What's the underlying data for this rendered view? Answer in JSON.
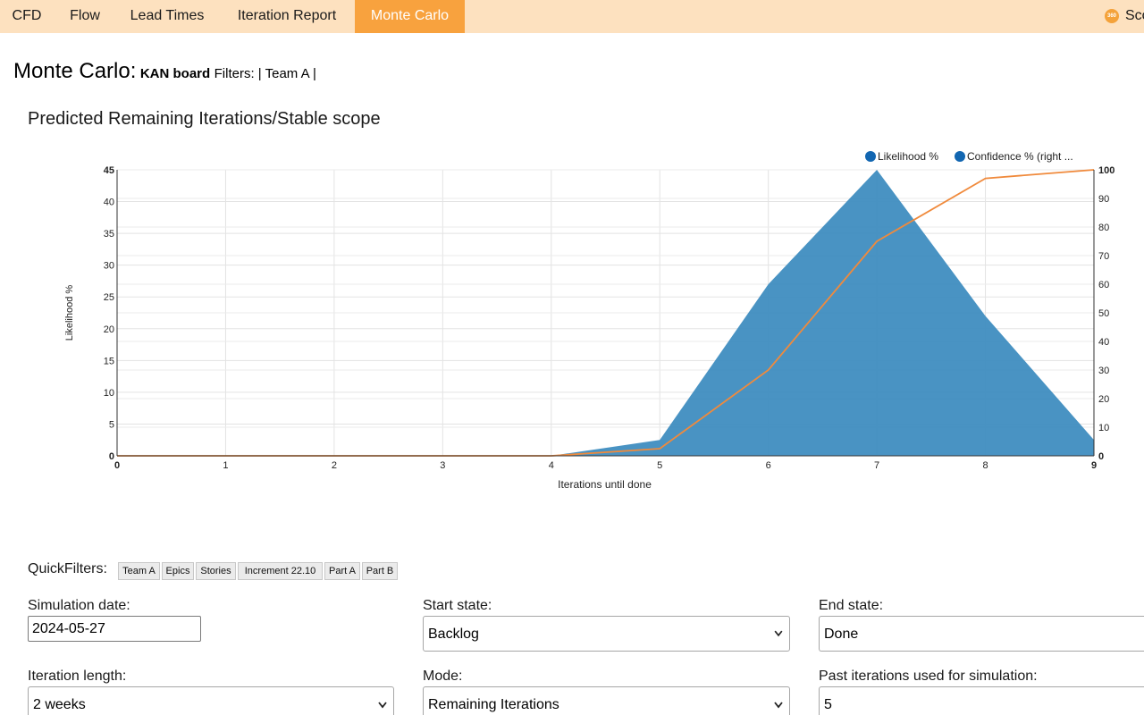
{
  "nav": {
    "tabs": [
      "CFD",
      "Flow",
      "Lead Times",
      "Iteration Report",
      "Monte Carlo"
    ],
    "active_index": 4,
    "brand_label": "Sco",
    "brand_icon_text": "360"
  },
  "page": {
    "title": "Monte Carlo:",
    "board": "KAN board",
    "filters": "Filters: | Team A |"
  },
  "chart_title": "Predicted Remaining Iterations/Stable scope",
  "chart_data": {
    "type": "area",
    "x": [
      0,
      1,
      2,
      3,
      4,
      5,
      6,
      7,
      8,
      9
    ],
    "x_ticks": [
      "0",
      "1",
      "2",
      "3",
      "4",
      "5",
      "6",
      "7",
      "8",
      "9"
    ],
    "xlabel": "Iterations until done",
    "ylabel": "Likelihood %",
    "ylim": [
      0,
      45
    ],
    "y_ticks": [
      "0",
      "5",
      "10",
      "15",
      "20",
      "25",
      "30",
      "35",
      "40",
      "45"
    ],
    "y2lim": [
      0,
      100
    ],
    "y2_ticks": [
      "0",
      "10",
      "20",
      "30",
      "40",
      "50",
      "60",
      "70",
      "80",
      "90",
      "100"
    ],
    "grid": true,
    "legend_position": "top-right",
    "series": [
      {
        "name": "Likelihood %",
        "type": "area",
        "axis": "left",
        "color": "#3f8dc0",
        "values": [
          0,
          0,
          0,
          0,
          0,
          2.5,
          27,
          45,
          22,
          2.5
        ]
      },
      {
        "name": "Confidence % (right ...",
        "type": "line",
        "axis": "right",
        "color": "#f08a3c",
        "values": [
          0,
          0,
          0,
          0,
          0,
          2.5,
          30,
          75,
          97,
          100
        ]
      }
    ],
    "legend_marker_color": "#1266b1"
  },
  "quickfilters": {
    "label": "QuickFilters:",
    "items": [
      {
        "label": "Team A",
        "active": true
      },
      {
        "label": "Epics",
        "active": false
      },
      {
        "label": "Stories",
        "active": false
      },
      {
        "label": "Increment 22.10",
        "active": false
      },
      {
        "label": "Part A",
        "active": false
      },
      {
        "label": "Part B",
        "active": false
      }
    ]
  },
  "form": {
    "simulation_date": {
      "label": "Simulation date:",
      "value": "2024-05-27"
    },
    "start_state": {
      "label": "Start state:",
      "value": "Backlog"
    },
    "end_state": {
      "label": "End state:",
      "value": "Done"
    },
    "iteration_length": {
      "label": "Iteration length:",
      "value": "2 weeks"
    },
    "mode": {
      "label": "Mode:",
      "value": "Remaining Iterations"
    },
    "past_iterations": {
      "label": "Past iterations used for simulation:",
      "value": "5"
    }
  }
}
